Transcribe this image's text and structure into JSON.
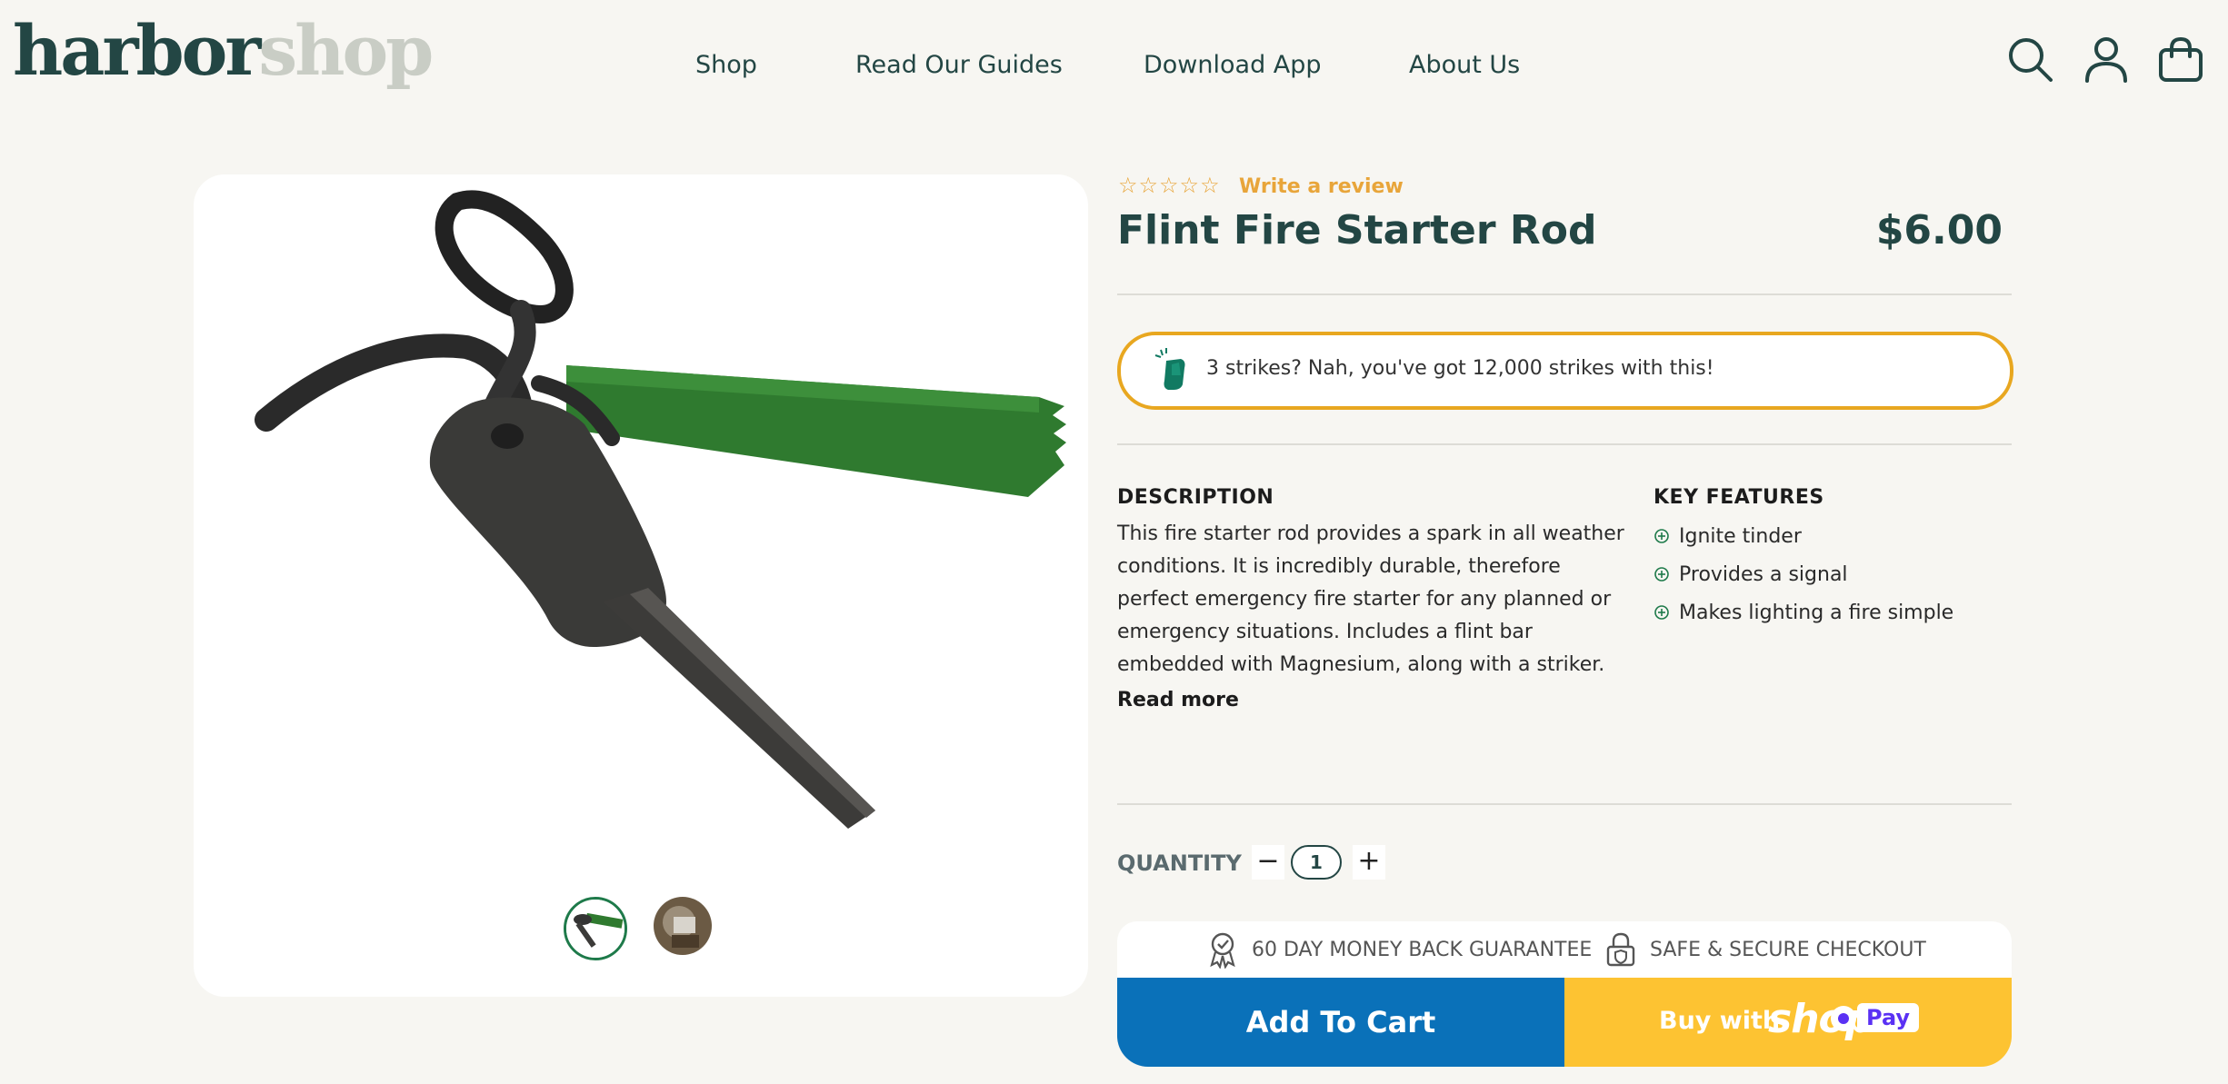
{
  "header": {
    "logo_part1": "harbor",
    "logo_part2": "shop",
    "nav": [
      "Shop",
      "Read Our Guides",
      "Download App",
      "About Us"
    ],
    "icons": [
      "search-icon",
      "account-icon",
      "cart-icon"
    ]
  },
  "product": {
    "review_link": "Write a review",
    "star_rating": 0,
    "star_count": 5,
    "title": "Flint Fire Starter Rod",
    "price": "$6.00",
    "promo_text": "3 strikes? Nah, you've got 12,000 strikes with this!",
    "description_heading": "DESCRIPTION",
    "description": "This fire starter rod provides a spark in all weather conditions. It is incredibly durable, therefore perfect emergency fire starter for any planned or emergency situations. Includes a flint bar embedded with Magnesium, along with a striker.",
    "read_more": "Read more",
    "features_heading": "KEY FEATURES",
    "features": [
      "Ignite tinder",
      "Provides a signal",
      "Makes lighting a fire simple"
    ],
    "quantity_label": "QUANTITY",
    "quantity_value": "1",
    "quantity_minus": "−",
    "quantity_plus": "+",
    "guarantee_money": "60 DAY MONEY BACK GUARANTEE",
    "guarantee_secure": "SAFE & SECURE CHECKOUT",
    "add_to_cart": "Add To Cart",
    "buy_with": "Buy with",
    "shop_word": "shop",
    "pay_word": "Pay"
  },
  "gallery": {
    "thumbnail_count": 2,
    "active_thumbnail": 1
  },
  "colors": {
    "brand_dark": "#234644",
    "accent_orange": "#e8a720",
    "cart_blue": "#0a71b9",
    "shop_yellow": "#fdc332",
    "feature_green": "#1e7a4a"
  }
}
